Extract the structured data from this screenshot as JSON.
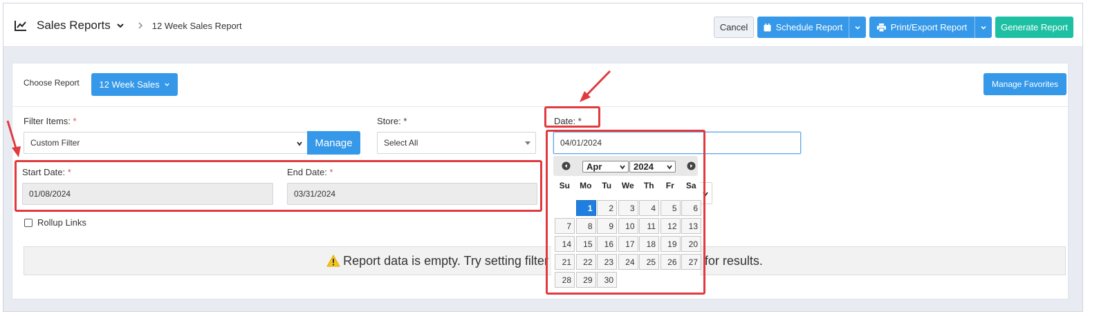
{
  "header": {
    "title": "Sales Reports",
    "breadcrumb": "12 Week Sales Report",
    "cancel_label": "Cancel",
    "schedule_label": "Schedule Report",
    "print_label": "Print/Export Report",
    "generate_label": "Generate Report"
  },
  "report": {
    "choose_label": "Choose Report",
    "selected": "12 Week Sales",
    "favorites_label": "Manage Favorites"
  },
  "filters": {
    "filter_items_label": "Filter Items:",
    "filter_items_value": "Custom Filter",
    "manage_label": "Manage",
    "store_label": "Store:",
    "store_value": "Select All",
    "date_label": "Date:",
    "date_value": "04/01/2024",
    "start_label": "Start Date:",
    "start_value": "01/08/2024",
    "end_label": "End Date:",
    "end_value": "03/31/2024",
    "required_mark": "*",
    "rollup_label": "Rollup Links"
  },
  "message": {
    "text_before": "Report data is empty. Try setting filter",
    "text_after": "for results."
  },
  "datepicker": {
    "month": "Apr",
    "year": "2024",
    "weekdays": [
      "Su",
      "Mo",
      "Tu",
      "We",
      "Th",
      "Fr",
      "Sa"
    ],
    "days": [
      "1",
      "2",
      "3",
      "4",
      "5",
      "6",
      "7",
      "8",
      "9",
      "10",
      "11",
      "12",
      "13",
      "14",
      "15",
      "16",
      "17",
      "18",
      "19",
      "20",
      "21",
      "22",
      "23",
      "24",
      "25",
      "26",
      "27",
      "28",
      "29",
      "30"
    ],
    "first_weekday": 1,
    "selected_day": "1"
  },
  "colors": {
    "primary": "#3598e8",
    "generate": "#1ec0a3",
    "annotation": "#e0393e",
    "required": "#d9534f"
  }
}
